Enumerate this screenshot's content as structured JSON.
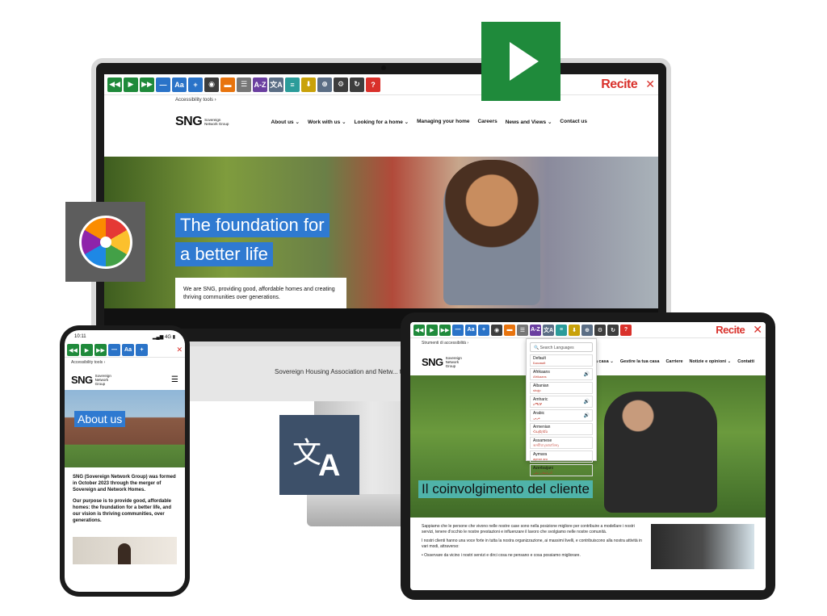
{
  "toolbar": {
    "buttons": [
      {
        "name": "rewind-icon",
        "glyph": "◀◀",
        "color": "g"
      },
      {
        "name": "play-icon",
        "glyph": "▶",
        "color": "g"
      },
      {
        "name": "fast-forward-icon",
        "glyph": "▶▶",
        "color": "g"
      },
      {
        "name": "decrease-text-icon",
        "glyph": "—",
        "color": "bl"
      },
      {
        "name": "font-icon",
        "glyph": "Aa",
        "color": "bl"
      },
      {
        "name": "increase-text-icon",
        "glyph": "+",
        "color": "bl"
      },
      {
        "name": "color-wheel-icon",
        "glyph": "◉",
        "color": "dk"
      },
      {
        "name": "ruler-icon",
        "glyph": "▬",
        "color": "or"
      },
      {
        "name": "margin-icon",
        "glyph": "☰",
        "color": "gr"
      },
      {
        "name": "dictionary-icon",
        "glyph": "A-Z",
        "color": "pu"
      },
      {
        "name": "translate-icon",
        "glyph": "文A",
        "color": "sl"
      },
      {
        "name": "text-mode-icon",
        "glyph": "≡",
        "color": "te"
      },
      {
        "name": "download-icon",
        "glyph": "⬇",
        "color": "ye"
      },
      {
        "name": "magnifier-icon",
        "glyph": "⊕",
        "color": "sl"
      },
      {
        "name": "settings-icon",
        "glyph": "⚙",
        "color": "dk"
      },
      {
        "name": "reset-icon",
        "glyph": "↻",
        "color": "dk"
      },
      {
        "name": "help-icon",
        "glyph": "?",
        "color": "rd"
      }
    ],
    "logo": "Recite",
    "close": "✕"
  },
  "desktop": {
    "breadcrumb": "Accessibility tools  ›",
    "logo": "SNG",
    "logo_sub": "Sovereign Network Group",
    "nav": [
      "About us ⌄",
      "Work with us ⌄",
      "Looking for a home ⌄",
      "Managing your home",
      "Careers",
      "News and Views ⌄",
      "Contact us"
    ],
    "hero_line1": "The foundation for",
    "hero_line2": "a better life",
    "intro": "We are SNG, providing good, affordable homes and creating thriving communities over generations.",
    "caption": "Sovereign Housing Association and Netw... together as SNG (Sovereign N..."
  },
  "phone": {
    "time": "10:11",
    "signal": "▂▄▆ 4G ▮",
    "breadcrumb": "Accessibility tools  ›",
    "logo": "SNG",
    "logo_sub": "Sovereign Network Group",
    "menu": "☰",
    "hero": "About us",
    "para1": "SNG (Sovereign Network Group) was formed in October 2023 through the merger of Sovereign and Network Homes.",
    "para2": "Our purpose is to provide good, affordable homes: the foundation for a better life, and our vision is thriving communities, over generations."
  },
  "tablet": {
    "breadcrumb": "Strumenti di accessibilità  ›",
    "logo": "SNG",
    "logo_sub": "Sovereign Network Group",
    "nav": [
      "Chi siamo ⌄",
      "...a casa ⌄",
      "Gestire la tua casa",
      "Carriere",
      "Notizie e opinioni ⌄",
      "Contatti"
    ],
    "hero": "Il coinvolgimento del cliente",
    "para1": "Sappiamo che le persone che vivono nelle nostre case sono nella posizione migliore per contribuire a modellare i nostri servizi, tenere d'occhio le nostre prestazioni e influenzare il lavoro che svolgiamo nelle nostre comunità.",
    "para2": "I nostri clienti hanno una voce forte in tutta la nostra organizzazione, ai massimi livelli, e contribuiscono alla nostra attività in vari modi, attraverso:",
    "bullet": "Osservare da vicino i nostri servizi e dirci cosa ne pensano e cosa possiamo migliorare.",
    "lang_search": "Search Languages",
    "languages": [
      {
        "name": "Default",
        "native": "Базовий",
        "speaker": false
      },
      {
        "name": "Afrikaans",
        "native": "Afrikaans",
        "speaker": true
      },
      {
        "name": "Albanian",
        "native": "shqip",
        "speaker": false
      },
      {
        "name": "Amharic",
        "native": "አማርኛ",
        "speaker": true
      },
      {
        "name": "Arabic",
        "native": "عربي",
        "speaker": true
      },
      {
        "name": "Armenian",
        "native": "Հայերեն",
        "speaker": false
      },
      {
        "name": "Assamese",
        "native": "অসমীয়া (আচামিজ)",
        "speaker": false
      },
      {
        "name": "Aymara",
        "native": "aymar aru",
        "speaker": false
      },
      {
        "name": "Azerbaijani",
        "native": "آذربایجان دیلی",
        "speaker": false
      }
    ]
  },
  "tiles": {
    "translate_glyph_a": "文",
    "translate_glyph_b": "A"
  }
}
